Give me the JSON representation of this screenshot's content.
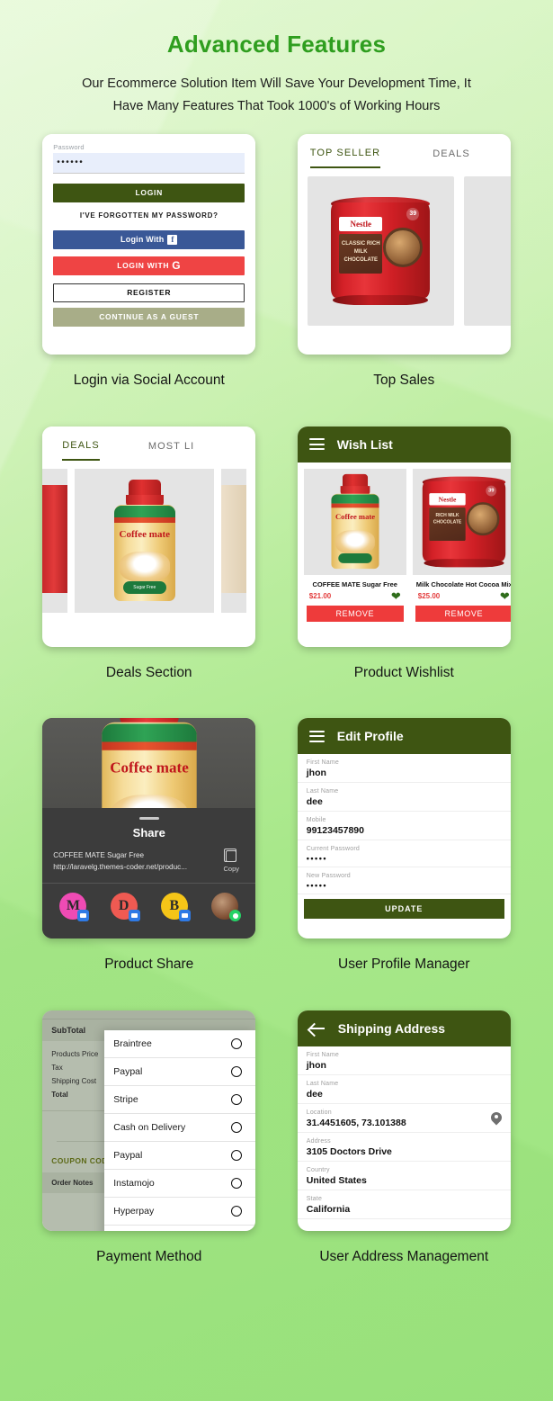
{
  "header": {
    "title": "Advanced Features",
    "subtitle": "Our Ecommerce Solution Item Will Save Your Development Time, It Have Many Features That Took 1000's of Working Hours"
  },
  "colors": {
    "title_green": "#2f9e1f",
    "appbar_green": "#3e5512",
    "accent_red": "#ee3b3b",
    "facebook_blue": "#3a5897",
    "google_red": "#ef4444",
    "guest_olive": "#a8ad88"
  },
  "features": [
    {
      "caption": "Login via Social Account"
    },
    {
      "caption": "Top Sales"
    },
    {
      "caption": "Deals Section"
    },
    {
      "caption": "Product Wishlist"
    },
    {
      "caption": "Product Share"
    },
    {
      "caption": "User Profile Manager"
    },
    {
      "caption": "Payment Method"
    },
    {
      "caption": "User Address Management"
    }
  ],
  "login_screen": {
    "password_label": "Password",
    "password_value": "••••••",
    "login_button": "LOGIN",
    "forgot_link": "I'VE FORGOTTEN MY PASSWORD?",
    "facebook_button": "Login With",
    "facebook_badge": "f",
    "google_button": "LOGIN WITH",
    "google_badge": "G",
    "register_button": "REGISTER",
    "guest_button": "CONTINUE AS A GUEST"
  },
  "top_seller_screen": {
    "tab_active": "TOP SELLER",
    "tab_inactive": "DEALS",
    "product_brand": "Nestle",
    "product_sub": "CLASSIC RICH MILK CHOCOLATE",
    "product_badge": "39"
  },
  "deals_screen": {
    "tab_active": "DEALS",
    "tab_inactive": "MOST LI",
    "product_brand": "Coffee mate",
    "product_sub": "Sugar Free"
  },
  "wishlist_screen": {
    "title": "Wish List",
    "items": [
      {
        "name": "COFFEE MATE Sugar Free",
        "price": "$21.00",
        "remove": "REMOVE"
      },
      {
        "name": "Milk Chocolate Hot Cocoa Mix",
        "price": "$25.00",
        "remove": "REMOVE"
      }
    ]
  },
  "share_screen": {
    "title": "Share",
    "link_text": "COFFEE MATE Sugar Free http://laravelg.themes-coder.net/produc...",
    "copy_label": "Copy",
    "apps": [
      "M",
      "D",
      "B",
      ""
    ]
  },
  "profile_screen": {
    "title": "Edit Profile",
    "fields": [
      {
        "label": "First Name",
        "value": "jhon"
      },
      {
        "label": "Last Name",
        "value": "dee"
      },
      {
        "label": "Mobile",
        "value": "99123457890"
      },
      {
        "label": "Current Password",
        "value": "•••••"
      },
      {
        "label": "New Password",
        "value": "•••••"
      }
    ],
    "update_button": "UPDATE"
  },
  "payment_screen": {
    "subtotal_label": "SubTotal",
    "summary_lines": [
      "Products Price",
      "Tax",
      "Shipping Cost",
      "Total"
    ],
    "coupon_placeholder": "coupon code",
    "coupon_codes_label": "COUPON CODES",
    "order_notes_label": "Order Notes",
    "options": [
      "Braintree",
      "Paypal",
      "Stripe",
      "Cash on Delivery",
      "Paypal",
      "Instamojo",
      "Hyperpay"
    ]
  },
  "address_screen": {
    "title": "Shipping Address",
    "fields": [
      {
        "label": "First Name",
        "value": "jhon"
      },
      {
        "label": "Last Name",
        "value": "dee"
      },
      {
        "label": "Location",
        "value": "31.4451605, 73.101388"
      },
      {
        "label": "Address",
        "value": "3105  Doctors Drive"
      },
      {
        "label": "Country",
        "value": "United States"
      },
      {
        "label": "State",
        "value": "California"
      }
    ]
  }
}
